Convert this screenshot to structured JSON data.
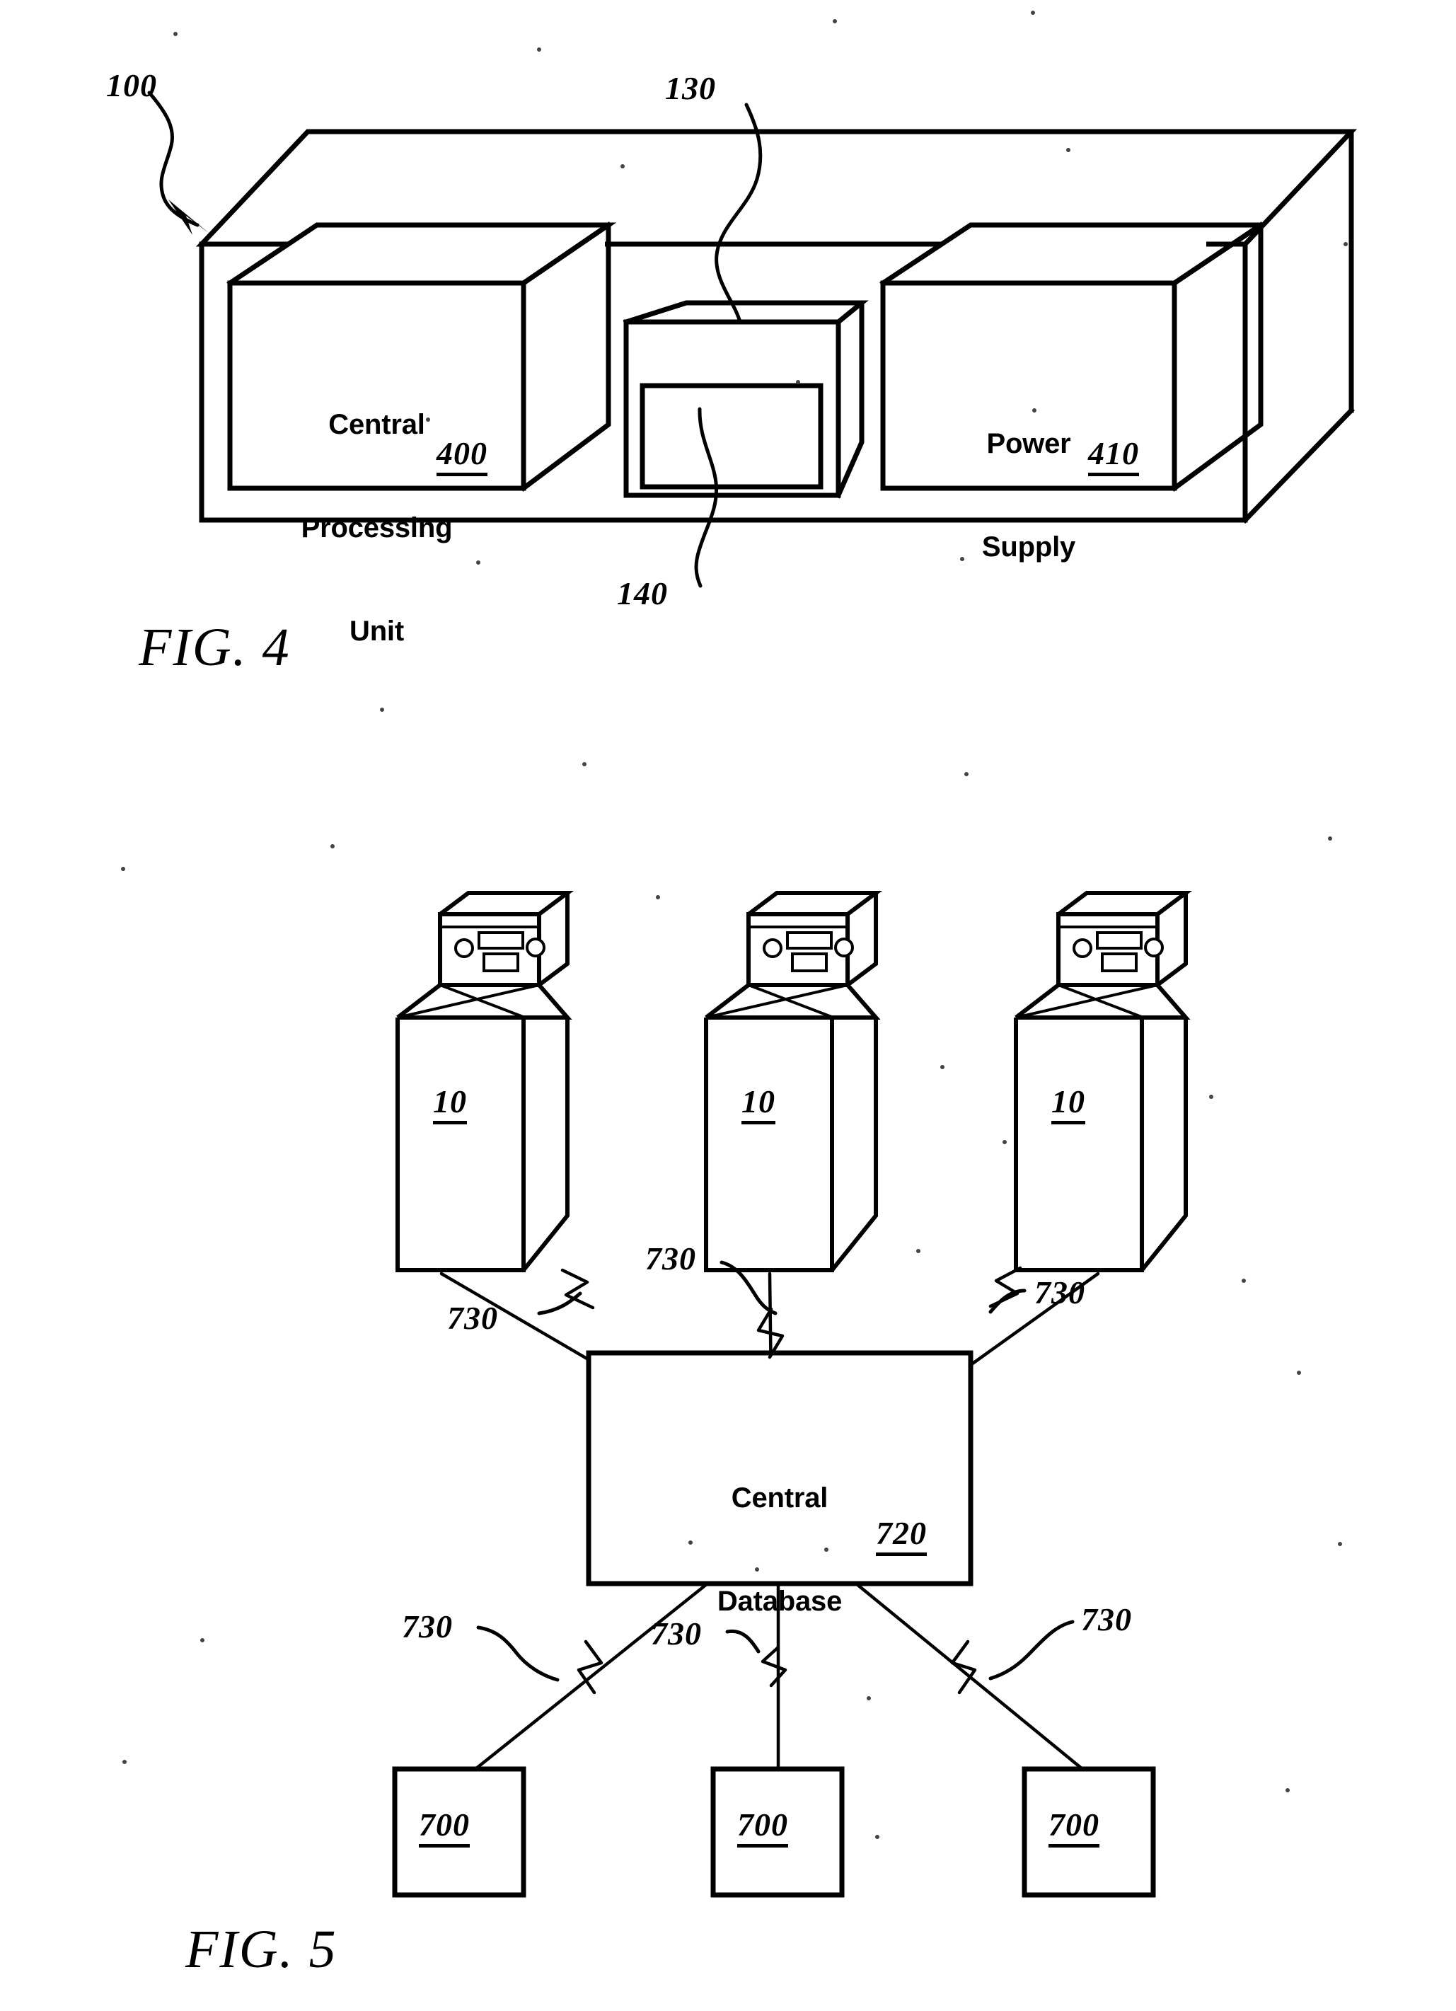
{
  "document": {
    "type": "patent-drawing-sheet",
    "background_color": "#ffffff",
    "ink_color": "#000000"
  },
  "figures": [
    {
      "id": "fig4",
      "caption": "FIG. 4",
      "title_ref": "100",
      "blocks": [
        {
          "id": "cpu",
          "label": "Central\nProcessing\nUnit",
          "ref": "400"
        },
        {
          "id": "display",
          "label": "",
          "ref": "130"
        },
        {
          "id": "power",
          "label": "Power\nSupply",
          "ref": "410"
        }
      ],
      "callouts": [
        {
          "ref": "100",
          "target": "enclosure"
        },
        {
          "ref": "130",
          "target": "display-housing"
        },
        {
          "ref": "140",
          "target": "display-screen"
        }
      ]
    },
    {
      "id": "fig5",
      "caption": "FIG. 5",
      "terminals": [
        {
          "ref": "10"
        },
        {
          "ref": "10"
        },
        {
          "ref": "10"
        }
      ],
      "hub": {
        "label": "Central\nDatabase",
        "ref": "720"
      },
      "endpoints": [
        {
          "ref": "700"
        },
        {
          "ref": "700"
        },
        {
          "ref": "700"
        }
      ],
      "links": [
        {
          "ref": "730"
        },
        {
          "ref": "730"
        },
        {
          "ref": "730"
        },
        {
          "ref": "730"
        },
        {
          "ref": "730"
        },
        {
          "ref": "730"
        }
      ]
    }
  ],
  "labels": {
    "fig4_caption": "FIG. 4",
    "fig5_caption": "FIG. 5",
    "cpu_line1": "Central",
    "cpu_line2": "Processing",
    "cpu_line3": "Unit",
    "cpu_ref": "400",
    "power_line1": "Power",
    "power_line2": "Supply",
    "power_ref": "410",
    "enclosure_ref": "100",
    "display_ref": "130",
    "screen_ref": "140",
    "db_line1": "Central",
    "db_line2": "Database",
    "db_ref": "720",
    "terminal_ref": "10",
    "endpoint_ref": "700",
    "link_ref": "730"
  }
}
